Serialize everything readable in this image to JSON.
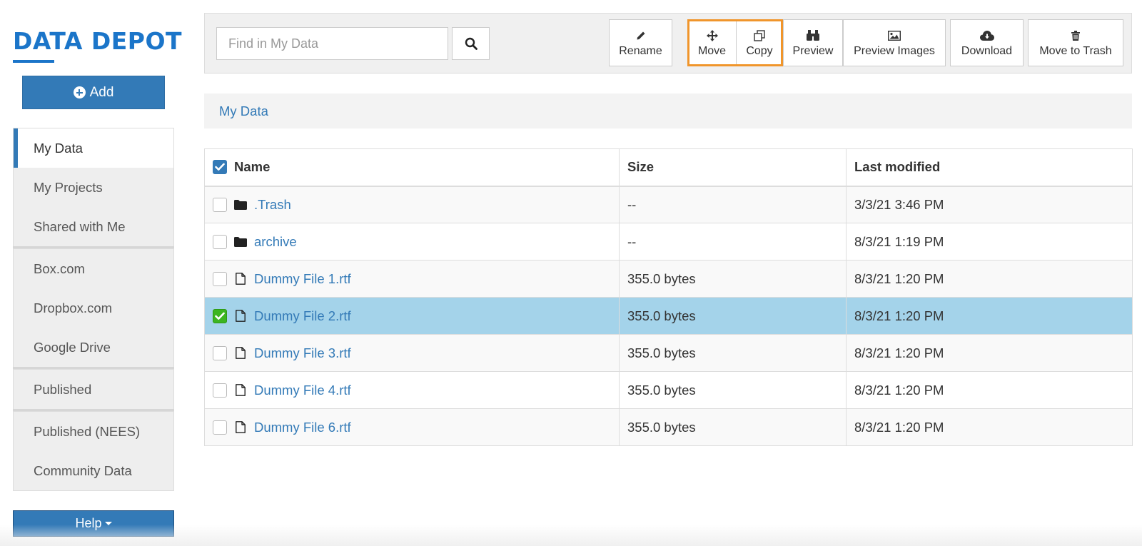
{
  "app": {
    "logo_text": "DATA DEPOT"
  },
  "sidebar": {
    "add_label": "Add",
    "groups": [
      {
        "items": [
          {
            "label": "My Data",
            "active": true
          },
          {
            "label": "My Projects"
          },
          {
            "label": "Shared with Me"
          }
        ]
      },
      {
        "items": [
          {
            "label": "Box.com"
          },
          {
            "label": "Dropbox.com"
          },
          {
            "label": "Google Drive"
          }
        ]
      },
      {
        "items": [
          {
            "label": "Published"
          }
        ]
      },
      {
        "items": [
          {
            "label": "Published (NEES)"
          },
          {
            "label": "Community Data"
          }
        ]
      }
    ],
    "help_label": "Help"
  },
  "toolbar": {
    "search_placeholder": "Find in My Data",
    "search_icon": "magnifier-icon",
    "buttons": [
      {
        "label": "Rename",
        "icon": "pencil-icon"
      },
      {
        "label": "Move",
        "icon": "move-arrows-icon",
        "highlighted": true
      },
      {
        "label": "Copy",
        "icon": "copy-icon",
        "highlighted": true
      },
      {
        "label": "Preview",
        "icon": "binoculars-icon"
      },
      {
        "label": "Preview Images",
        "icon": "image-icon"
      },
      {
        "label": "Download",
        "icon": "cloud-download-icon"
      },
      {
        "label": "Move to Trash",
        "icon": "trash-icon"
      }
    ],
    "highlight_color": "#f0952b"
  },
  "breadcrumb": {
    "label": "My Data"
  },
  "table": {
    "columns": [
      "Name",
      "Size",
      "Last modified"
    ],
    "rows": [
      {
        "name": ".Trash",
        "type": "folder",
        "size": "--",
        "modified": "3/3/21 3:46 PM",
        "checked": false
      },
      {
        "name": "archive",
        "type": "folder",
        "size": "--",
        "modified": "8/3/21 1:19 PM",
        "checked": false
      },
      {
        "name": "Dummy File 1.rtf",
        "type": "file",
        "size": "355.0 bytes",
        "modified": "8/3/21 1:20 PM",
        "checked": false
      },
      {
        "name": "Dummy File 2.rtf",
        "type": "file",
        "size": "355.0 bytes",
        "modified": "8/3/21 1:20 PM",
        "checked": true
      },
      {
        "name": "Dummy File 3.rtf",
        "type": "file",
        "size": "355.0 bytes",
        "modified": "8/3/21 1:20 PM",
        "checked": false
      },
      {
        "name": "Dummy File 4.rtf",
        "type": "file",
        "size": "355.0 bytes",
        "modified": "8/3/21 1:20 PM",
        "checked": false
      },
      {
        "name": "Dummy File 6.rtf",
        "type": "file",
        "size": "355.0 bytes",
        "modified": "8/3/21 1:20 PM",
        "checked": false
      }
    ]
  },
  "colors": {
    "brand": "#1b75c9",
    "primary": "#337ab7",
    "selected_row": "#a4d3ea",
    "checkbox_checked": "#3cb521"
  }
}
